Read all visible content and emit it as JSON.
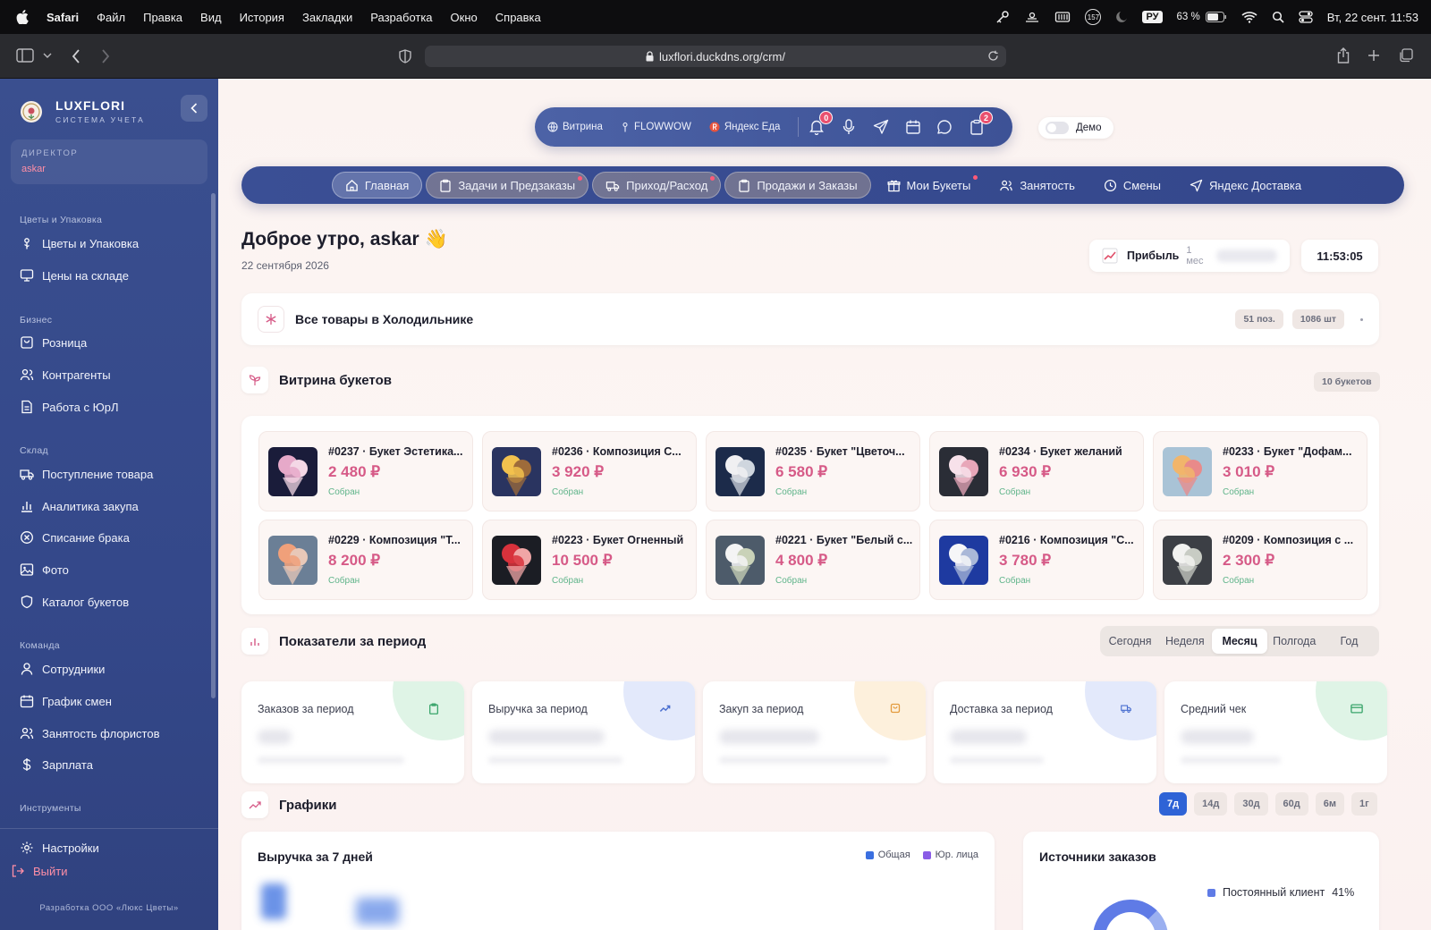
{
  "menubar": {
    "items": [
      "Safari",
      "Файл",
      "Правка",
      "Вид",
      "История",
      "Закладки",
      "Разработка",
      "Окно",
      "Справка"
    ],
    "badge": "157",
    "lang": "РУ",
    "battery": "63 %",
    "datetime": "Вт, 22 сент. 11:53"
  },
  "browser": {
    "url": "luxflori.duckdns.org/crm/"
  },
  "sidebar": {
    "brand": "LUXFLORI",
    "brand_sub": "СИСТЕМА УЧЕТА",
    "role": "ДИРЕКТОР",
    "user": "askar",
    "sections": [
      {
        "title": "Цветы и Упаковка",
        "items": [
          {
            "label": "Цветы и Упаковка",
            "icon": "flower-icon"
          },
          {
            "label": "Цены на складе",
            "icon": "monitor-icon"
          }
        ]
      },
      {
        "title": "Бизнес",
        "items": [
          {
            "label": "Розница",
            "icon": "bag-icon"
          },
          {
            "label": "Контрагенты",
            "icon": "users-icon"
          },
          {
            "label": "Работа с ЮрЛ",
            "icon": "document-icon"
          }
        ]
      },
      {
        "title": "Склад",
        "items": [
          {
            "label": "Поступление товара",
            "icon": "truck-icon"
          },
          {
            "label": "Аналитика закупа",
            "icon": "bar-chart-icon"
          },
          {
            "label": "Списание брака",
            "icon": "x-circle-icon"
          },
          {
            "label": "Фото",
            "icon": "image-icon"
          },
          {
            "label": "Каталог букетов",
            "icon": "shield-icon"
          }
        ]
      },
      {
        "title": "Команда",
        "items": [
          {
            "label": "Сотрудники",
            "icon": "user-icon"
          },
          {
            "label": "График смен",
            "icon": "calendar-icon"
          },
          {
            "label": "Занятость флористов",
            "icon": "users-icon"
          },
          {
            "label": "Зарплата",
            "icon": "dollar-icon"
          }
        ]
      },
      {
        "title": "Инструменты",
        "items": []
      }
    ],
    "settings": "Настройки",
    "logout": "Выйти",
    "footer": "Разработка ООО «Люкс Цветы»"
  },
  "quickbar": {
    "links": [
      {
        "label": "Витрина",
        "icon": "globe-icon"
      },
      {
        "label": "FLOWWOW",
        "icon": "flower-icon"
      },
      {
        "label": "Яндекс Еда",
        "icon": "yandex-eda-icon"
      }
    ],
    "notifications_count": "0",
    "cart_count": "2"
  },
  "demo_label": "Демо",
  "nav": {
    "tabs": [
      {
        "label": "Главная",
        "icon": "home-icon",
        "state": "active"
      },
      {
        "label": "Задачи и Предзаказы",
        "icon": "clipboard-icon",
        "state": "highlight",
        "dot": true
      },
      {
        "label": "Приход/Расход",
        "icon": "truck-icon",
        "state": "highlight",
        "dot": true
      },
      {
        "label": "Продажи и Заказы",
        "icon": "clipboard-icon",
        "state": "highlight"
      },
      {
        "label": "Мои Букеты",
        "icon": "gift-icon",
        "state": "",
        "dot": true
      },
      {
        "label": "Занятость",
        "icon": "users-icon",
        "state": ""
      },
      {
        "label": "Смены",
        "icon": "clock-icon",
        "state": ""
      },
      {
        "label": "Яндекс Доставка",
        "icon": "send-icon",
        "state": ""
      }
    ]
  },
  "greeting": {
    "text": "Доброе утро, askar 👋",
    "date": "22 сентября 2026"
  },
  "profit": {
    "label": "Прибыль",
    "period": "1 мес"
  },
  "clock": "11:53:05",
  "fridge": {
    "title": "Все товары в Холодильнике",
    "positions": "51 поз.",
    "pieces": "1086 шт"
  },
  "showcase": {
    "title": "Витрина букетов",
    "count": "10 букетов",
    "bouquets": [
      {
        "title": "#0237 · Букет Эстетика...",
        "price": "2 480 ₽",
        "status": "Собран"
      },
      {
        "title": "#0236 · Композиция С...",
        "price": "3 920 ₽",
        "status": "Собран"
      },
      {
        "title": "#0235 · Букет \"Цветоч...",
        "price": "6 580 ₽",
        "status": "Собран"
      },
      {
        "title": "#0234 · Букет желаний",
        "price": "6 930 ₽",
        "status": "Собран"
      },
      {
        "title": "#0233 · Букет \"Дофам...",
        "price": "3 010 ₽",
        "status": "Собран"
      },
      {
        "title": "#0229 · Композиция \"Т...",
        "price": "8 200 ₽",
        "status": "Собран"
      },
      {
        "title": "#0223 · Букет Огненный",
        "price": "10 500 ₽",
        "status": "Собран"
      },
      {
        "title": "#0221 · Букет \"Белый с...",
        "price": "4 800 ₽",
        "status": "Собран"
      },
      {
        "title": "#0216 · Композиция \"С...",
        "price": "3 780 ₽",
        "status": "Собран"
      },
      {
        "title": "#0209 · Композиция с ...",
        "price": "2 300 ₽",
        "status": "Собран"
      }
    ]
  },
  "metrics": {
    "title": "Показатели за период",
    "periods": [
      "Сегодня",
      "Неделя",
      "Месяц",
      "Полгода",
      "Год"
    ],
    "active_period": "Месяц",
    "cards": [
      {
        "title": "Заказов за период",
        "icon": "clipboard-icon",
        "color": "#dff4e6",
        "icolor": "#3aa56b"
      },
      {
        "title": "Выручка за период",
        "icon": "trend-up-icon",
        "color": "#e3e9fb",
        "icolor": "#4a6fd0"
      },
      {
        "title": "Закуп за период",
        "icon": "bag-icon",
        "color": "#fdf0dc",
        "icolor": "#e39a3c"
      },
      {
        "title": "Доставка за период",
        "icon": "truck-icon",
        "color": "#e3e9fb",
        "icolor": "#4a6fd0"
      },
      {
        "title": "Средний чек",
        "icon": "card-icon",
        "color": "#dff4e6",
        "icolor": "#3aa56b"
      }
    ]
  },
  "charts": {
    "title": "Графики",
    "ranges": [
      "7д",
      "14д",
      "30д",
      "60д",
      "6м",
      "1г"
    ],
    "active_range": "7д",
    "revenue_title": "Выручка за 7 дней",
    "legend": [
      {
        "label": "Общая",
        "color": "#3a6fe0"
      },
      {
        "label": "Юр. лица",
        "color": "#8a5ce6"
      }
    ],
    "sources_title": "Источники заказов",
    "sources_item": {
      "label": "Постоянный клиент",
      "pct": "41%"
    }
  },
  "colors": {
    "accent": "#3a4f95",
    "price": "#d65a87",
    "status": "#5fb48a",
    "badge": "#e9506f"
  }
}
